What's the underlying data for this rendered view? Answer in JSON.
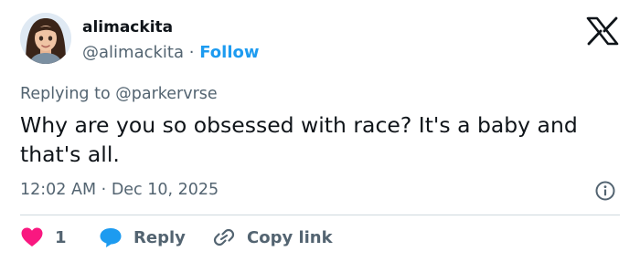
{
  "author": {
    "display_name": "alimackita",
    "handle": "@alimackita",
    "separator": "·",
    "follow_label": "Follow"
  },
  "reply_context": {
    "prefix": "Replying to",
    "handle": "@parkervrse"
  },
  "tweet": {
    "text": "Why are you so obsessed with race? It's a baby and that's all."
  },
  "meta": {
    "time": "12:02 AM",
    "separator": "·",
    "date": "Dec 10, 2025"
  },
  "actions": {
    "like_count": "1",
    "reply_label": "Reply",
    "copy_label": "Copy link"
  },
  "icons": {
    "brand": "x-logo-icon",
    "info": "info-icon",
    "like": "heart-icon",
    "reply": "speech-bubble-icon",
    "copy": "link-icon"
  },
  "colors": {
    "accent": "#1d9bf0",
    "heart": "#f91880",
    "text": "#0f1419",
    "muted": "#536471",
    "divider": "#cfd9de"
  }
}
